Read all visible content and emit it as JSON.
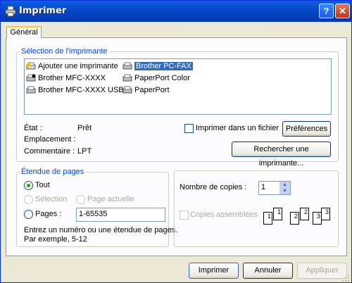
{
  "window": {
    "title": "Imprimer",
    "help_icon": "question-icon",
    "close_icon": "close-icon"
  },
  "tabs": [
    {
      "label": "Général"
    }
  ],
  "printer_selection": {
    "legend": "Sélection de l'imprimante",
    "printers": [
      {
        "name": "Ajouter une imprimante",
        "icon": "add-printer-icon",
        "selected": false
      },
      {
        "name": "Brother MFC-XXXX",
        "icon": "printer-default-icon",
        "selected": false
      },
      {
        "name": "Brother MFC-XXXX USB",
        "icon": "printer-icon",
        "selected": false
      },
      {
        "name": "Brother PC-FAX",
        "icon": "printer-icon",
        "selected": true
      },
      {
        "name": "PaperPort Color",
        "icon": "printer-icon",
        "selected": false
      },
      {
        "name": "PaperPort",
        "icon": "printer-icon",
        "selected": false
      }
    ],
    "status_label": "État :",
    "status_value": "Prêt",
    "location_label": "Emplacement :",
    "location_value": "",
    "comment_label": "Commentaire :",
    "comment_value": "LPT",
    "print_to_file_label": "Imprimer dans un fichier",
    "print_to_file_checked": false,
    "preferences_button": "Préférences",
    "find_printer_button": "Rechercher une imprimante..."
  },
  "page_range": {
    "legend": "Étendue de pages",
    "all_label": "Tout",
    "selection_label": "Sélection",
    "current_page_label": "Page actuelle",
    "pages_label": "Pages :",
    "pages_value": "1-65535",
    "selected_option": "all",
    "hint_line1": "Entrez un numéro ou une étendue de pages.",
    "hint_line2": "Par exemple, 5-12"
  },
  "copies": {
    "label": "Nombre de copies :",
    "value": "1",
    "collate_label": "Copies assemblées",
    "collate_checked": false,
    "collate_digits": [
      "1",
      "1",
      "2",
      "2",
      "3",
      "3"
    ]
  },
  "buttons": {
    "print": "Imprimer",
    "cancel": "Annuler",
    "apply": "Appliquer"
  },
  "colors": {
    "titlebar": "#0648c9",
    "legend": "#0046d5",
    "selection": "#316ac5",
    "dialog_bg": "#ece9d8"
  }
}
